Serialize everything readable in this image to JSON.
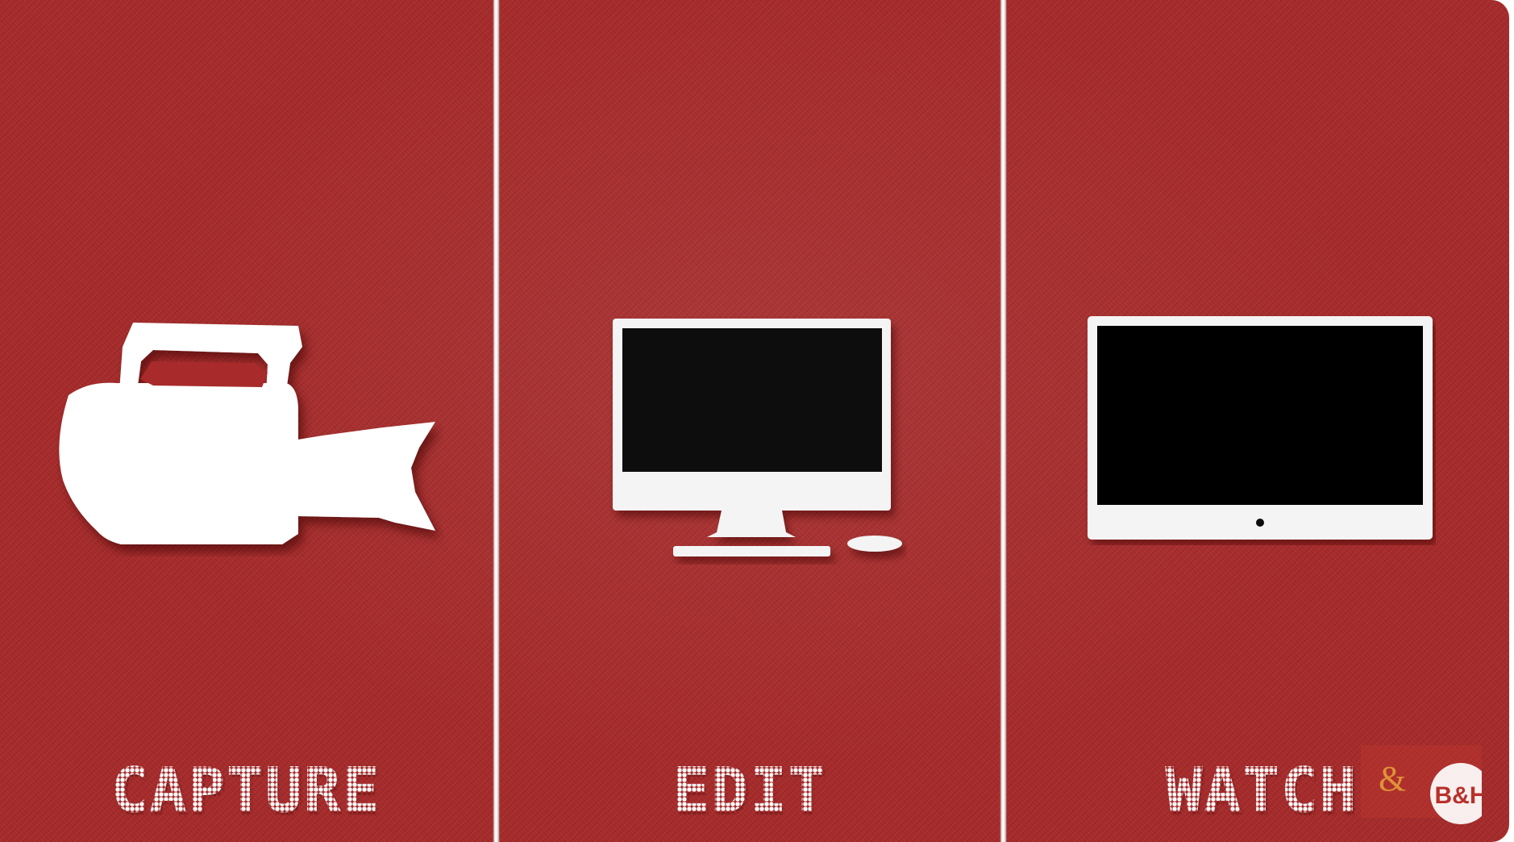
{
  "panels": [
    {
      "label": "CAPTURE",
      "icon": "video-camera-icon"
    },
    {
      "label": "EDIT",
      "icon": "desktop-computer-icon"
    },
    {
      "label": "WATCH",
      "icon": "tv-icon"
    }
  ],
  "watermark": {
    "logo": "B&H",
    "icon": "bh-logo-icon"
  },
  "colors": {
    "background": "#a82a2a",
    "icon_fill": "#ffffff",
    "screen": "#080808",
    "divider": "#f3eded"
  }
}
